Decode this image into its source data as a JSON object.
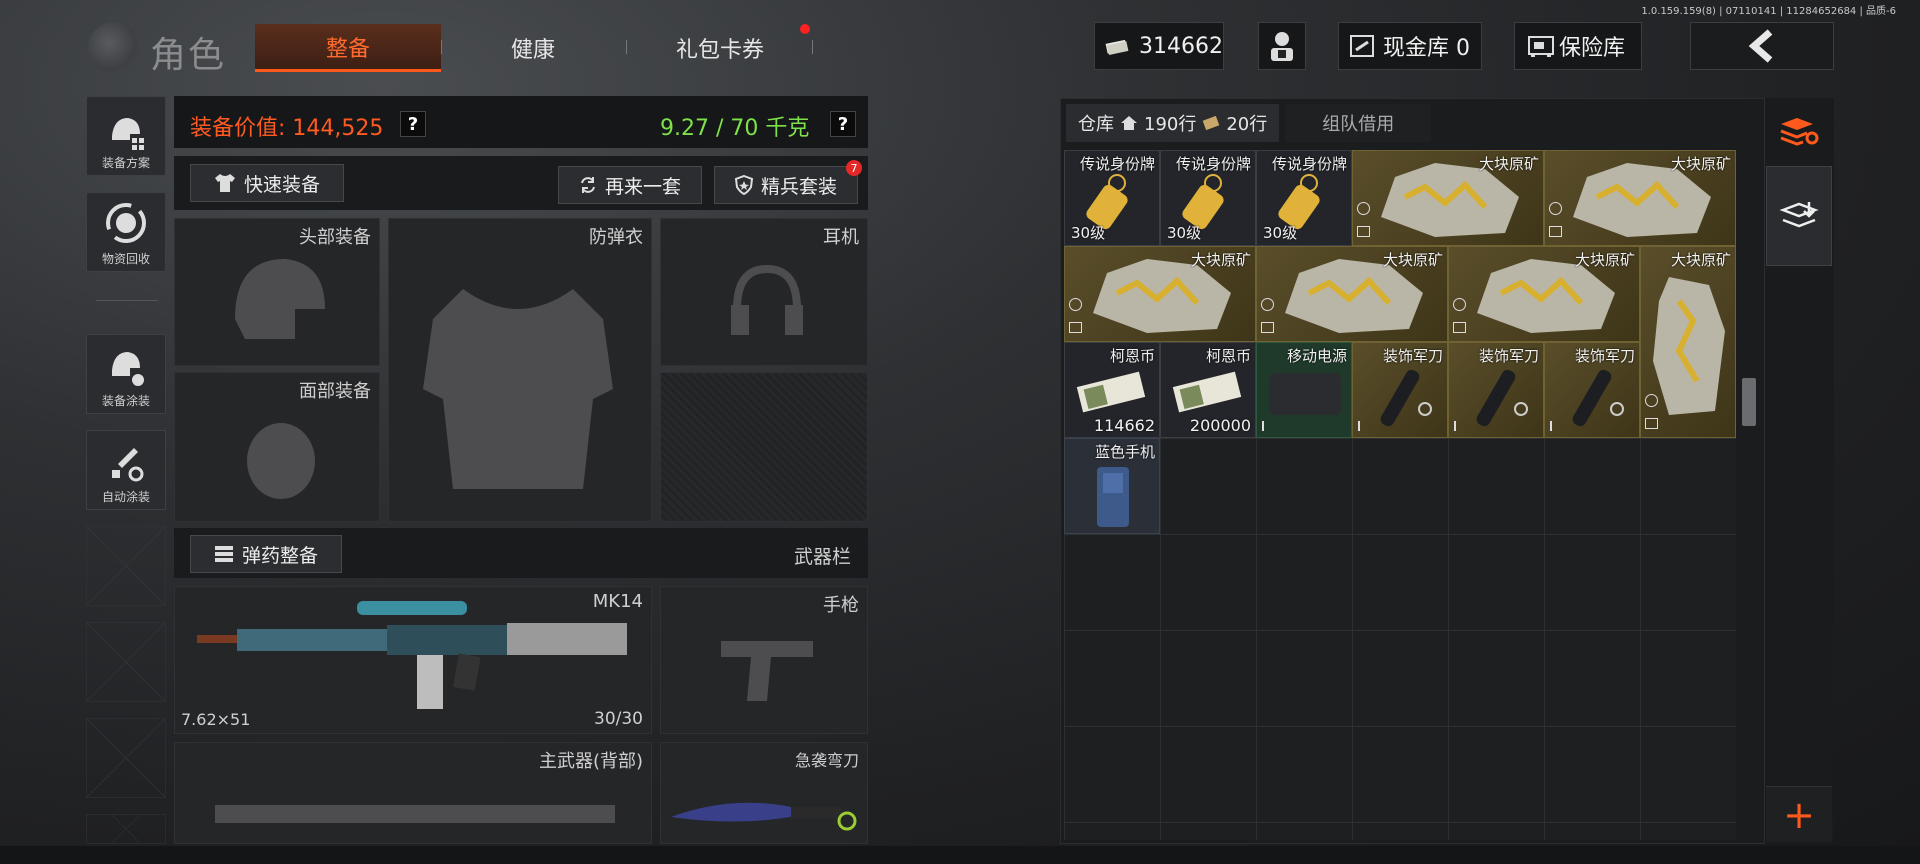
{
  "version": "1.0.159.159(8) | 07110141 | 11284652684 | 品质-6",
  "header": {
    "title": "角色",
    "tabs": [
      "整备",
      "健康",
      "礼包卡券"
    ],
    "money": "314662",
    "cash_vault": "现金库 0",
    "safe": "保险库"
  },
  "sidebar": [
    "装备方案",
    "物资回收",
    "装备涂装",
    "自动涂装"
  ],
  "equipment": {
    "value_label": "装备价值: 144,525",
    "weight": "9.27 / 70 千克",
    "quick_equip": "快速装备",
    "again": "再来一套",
    "elite": "精兵套装",
    "elite_badge": "7",
    "slots": {
      "head": "头部装备",
      "armor": "防弹衣",
      "earphone": "耳机",
      "face": "面部装备"
    },
    "ammo_btn": "弹药整备",
    "weapon_bar": "武器栏",
    "primary": {
      "name": "MK14",
      "caliber": "7.62×51",
      "ammo": "30/30"
    },
    "pistol": "手枪",
    "backpack_weapon": "主武器(背部)",
    "melee": "急袭弯刀"
  },
  "inventory": {
    "tab_label": "仓库",
    "rows_home": "190行",
    "rows_ticket": "20行",
    "team_tab": "组队借用",
    "items": {
      "tag": "传说身份牌",
      "tag_level": "30级",
      "ore": "大块原矿",
      "coin": "柯恩币",
      "coin_a": "114662",
      "coin_b": "200000",
      "power": "移动电源",
      "knife": "装饰军刀",
      "phone": "蓝色手机"
    }
  },
  "colors": {
    "accent": "#ff5a1c",
    "value": "#ff5a22",
    "weight": "#7ee04a",
    "gold_item": "#5a4e2a"
  }
}
